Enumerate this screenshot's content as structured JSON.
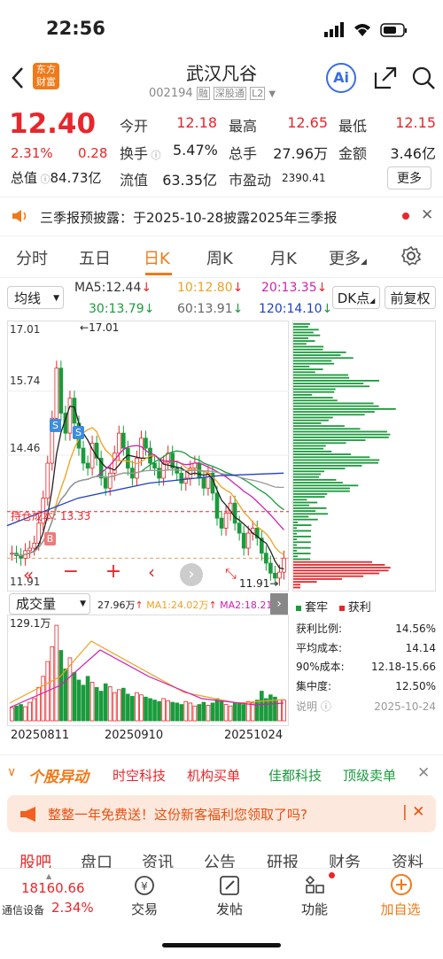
{
  "status_bar": {
    "time": "22:56"
  },
  "header": {
    "logo_line1": "东方",
    "logo_line2": "财富",
    "stock_name": "武汉凡谷",
    "stock_code": "002194",
    "tags": [
      "融",
      "深股通",
      "L2"
    ],
    "ai_label": "Ai"
  },
  "quote": {
    "price": "12.40",
    "pct": "2.31%",
    "change": "0.28",
    "open_label": "今开",
    "open": "12.18",
    "high_label": "最高",
    "high": "12.65",
    "low_label": "最低",
    "low": "12.15",
    "turnover_label": "换手",
    "turnover": "5.47%",
    "volume_label": "总手",
    "volume": "27.96万",
    "amount_label": "金额",
    "amount": "3.46亿",
    "mktcap_label": "总值",
    "mktcap": "84.73亿",
    "float_label": "流值",
    "float": "63.35亿",
    "pe_label": "市盈动",
    "pe": "2390.41",
    "more_button": "更多"
  },
  "notice": {
    "text": "三季报预披露：于2025-10-28披露2025年三季报"
  },
  "tabs": [
    "分时",
    "五日",
    "日K",
    "周K",
    "月K",
    "更多"
  ],
  "active_tab": "日K",
  "ma_bar": {
    "selector": "均线",
    "ma5": "MA5:12.44",
    "ma10": "10:12.80",
    "ma20": "20:13.35",
    "ma30": "30:13.79",
    "ma60": "60:13.91",
    "ma120": "120:14.10",
    "dk_button": "DK点",
    "adjust_button": "前复权"
  },
  "price_axis": [
    "17.01",
    "15.74",
    "14.46",
    "11.91"
  ],
  "annotations": {
    "high_mark": "17.01",
    "low_mark": "11.91",
    "cost_label": "持仓成本",
    "cost_value": "13.33",
    "s_label": "S",
    "b_label": "B"
  },
  "volume_bar": {
    "selector": "成交量",
    "vol": "27.96万",
    "ma1": "MA1:24.02万",
    "ma2": "MA2:18.21万",
    "axis_top": "129.1万"
  },
  "date_axis": [
    "20250811",
    "20250910",
    "20251024"
  ],
  "chip": {
    "legend_trapped": "套牢",
    "legend_profit": "获利",
    "rows": [
      {
        "label": "获利比例:",
        "value": "14.56%"
      },
      {
        "label": "平均成本:",
        "value": "14.14"
      },
      {
        "label": "90%成本:",
        "value": "12.18-15.66"
      },
      {
        "label": "集中度:",
        "value": "12.50%"
      }
    ],
    "note_label": "说明",
    "date": "2025-10-24"
  },
  "ticker": {
    "title": "个股异动",
    "items": [
      "时空科技",
      "机构买单",
      "佳都科技",
      "顶级卖单"
    ]
  },
  "promo": {
    "text": "整整一年免费送！这份新客福利您领取了吗?"
  },
  "sub_tabs": [
    "股吧",
    "盘口",
    "资讯",
    "公告",
    "研报",
    "财务",
    "资料"
  ],
  "bottom_nav": {
    "index_value": "18160.66",
    "index_name": "通信设备",
    "index_pct": "2.34%",
    "items": [
      "交易",
      "发帖",
      "功能",
      "加自选"
    ]
  },
  "colors": {
    "up": "#e8262b",
    "down": "#1a9b3c",
    "accent": "#f07a1a"
  }
}
